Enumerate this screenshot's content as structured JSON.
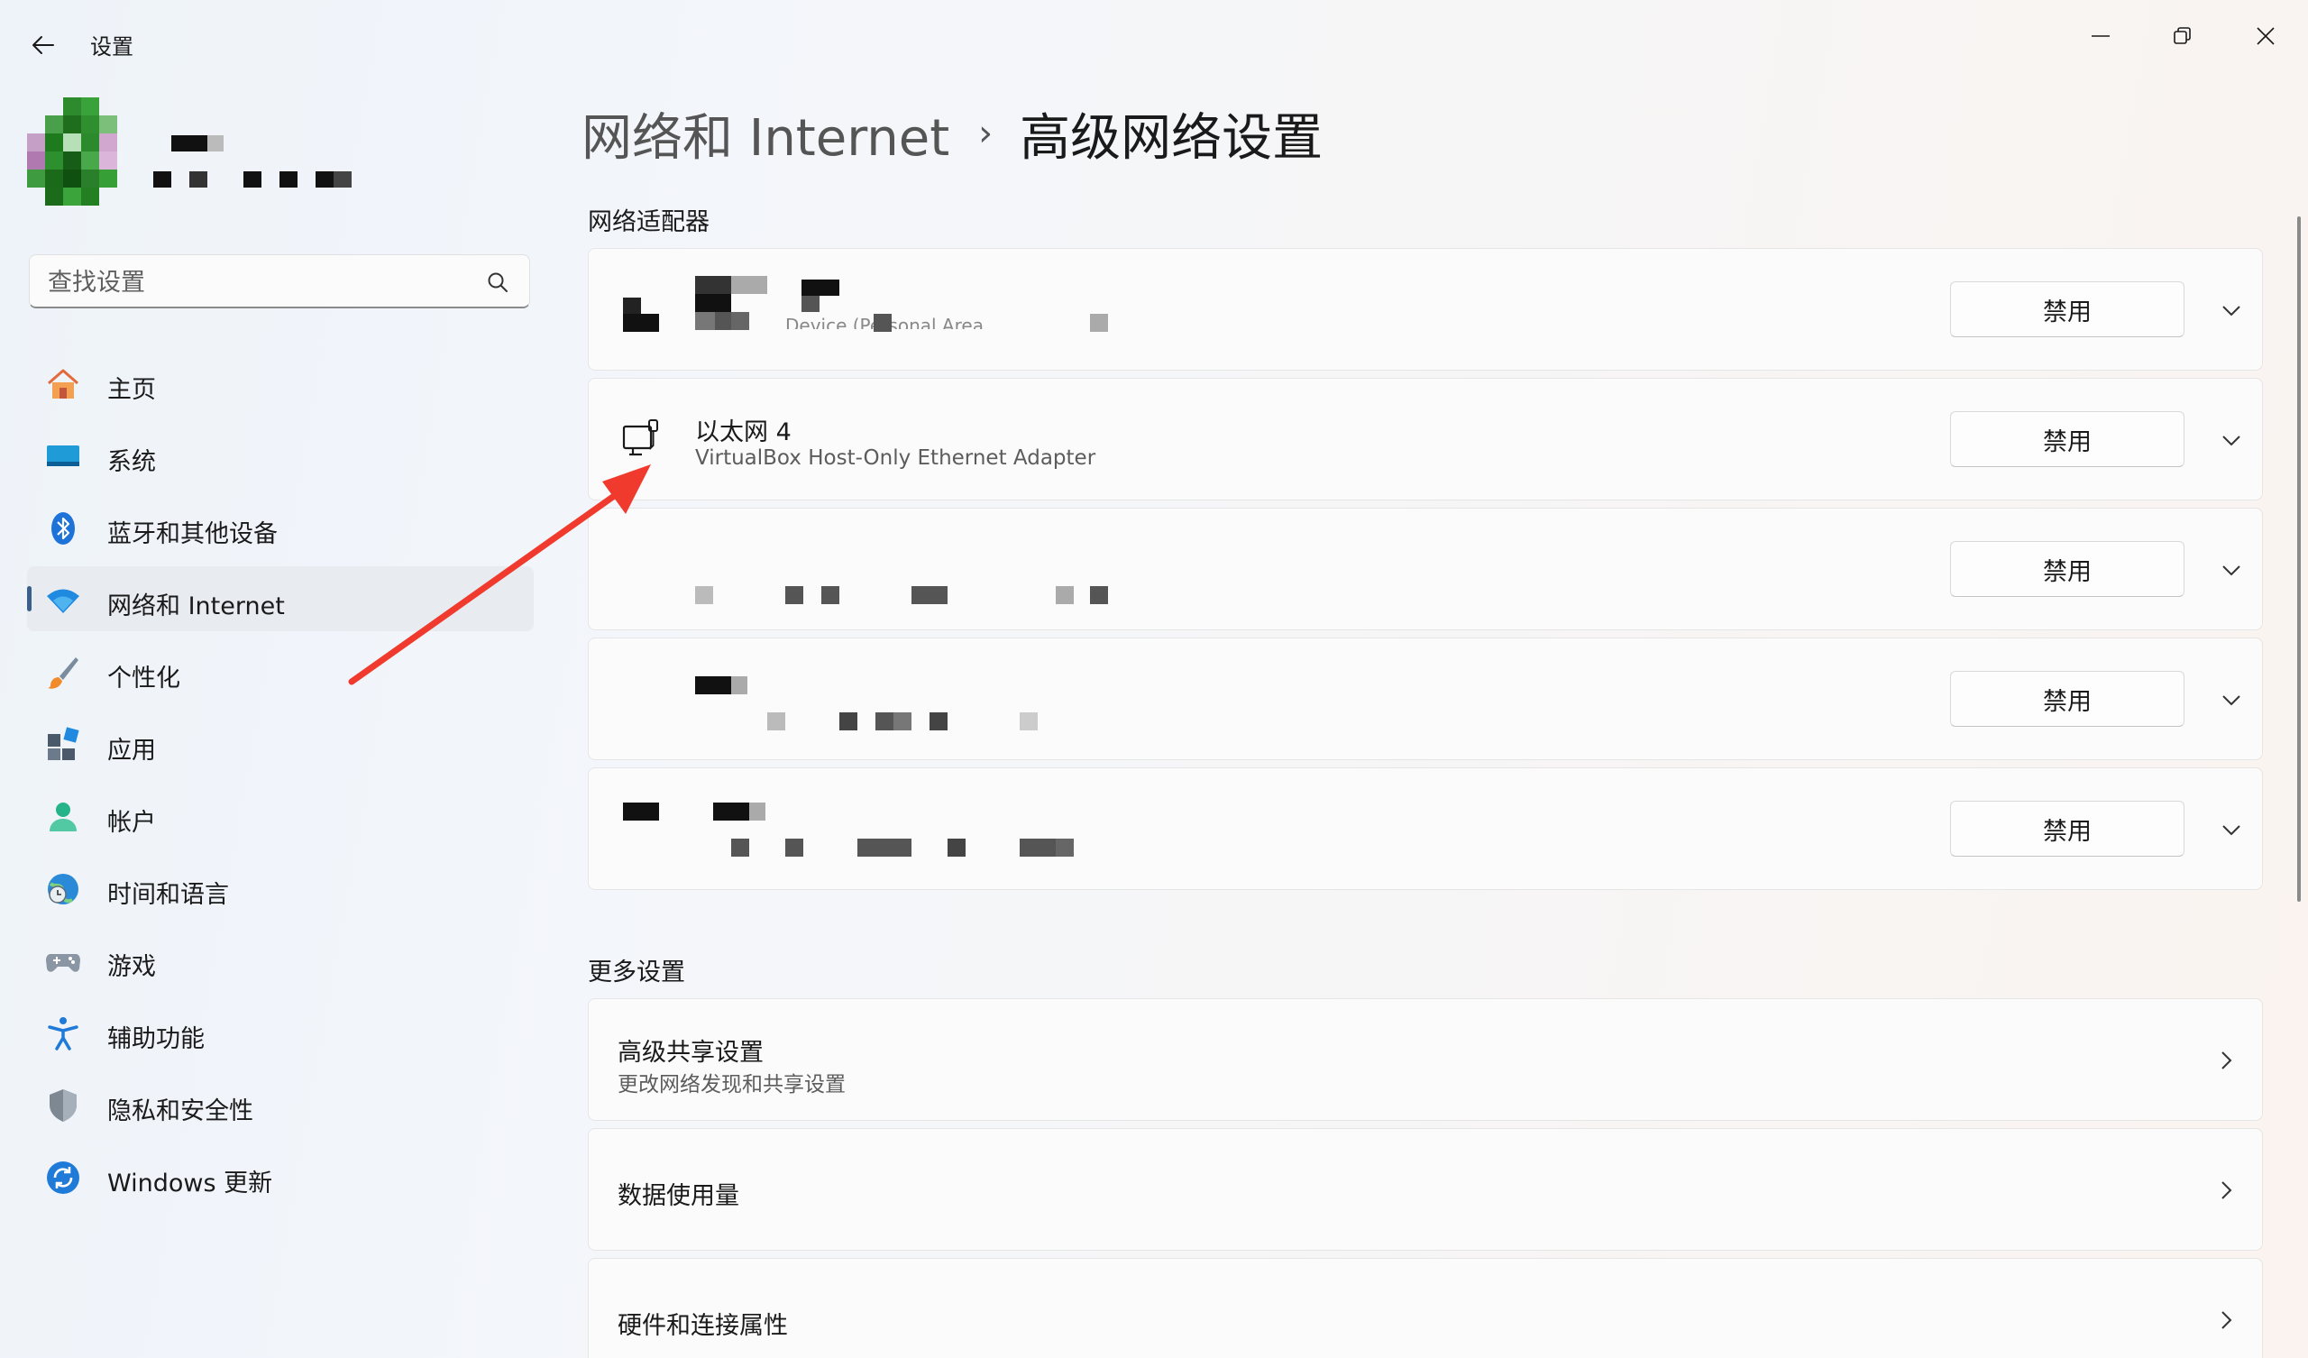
{
  "window": {
    "title": "设置"
  },
  "search": {
    "placeholder": "查找设置"
  },
  "sidebar": {
    "items": [
      {
        "label": "主页",
        "icon": "home-icon"
      },
      {
        "label": "系统",
        "icon": "system-icon"
      },
      {
        "label": "蓝牙和其他设备",
        "icon": "bluetooth-icon"
      },
      {
        "label": "网络和 Internet",
        "icon": "wifi-icon",
        "active": true
      },
      {
        "label": "个性化",
        "icon": "brush-icon"
      },
      {
        "label": "应用",
        "icon": "apps-icon"
      },
      {
        "label": "帐户",
        "icon": "account-icon"
      },
      {
        "label": "时间和语言",
        "icon": "globe-clock-icon"
      },
      {
        "label": "游戏",
        "icon": "gamepad-icon"
      },
      {
        "label": "辅助功能",
        "icon": "accessibility-icon"
      },
      {
        "label": "隐私和安全性",
        "icon": "shield-icon"
      },
      {
        "label": "Windows 更新",
        "icon": "update-icon"
      }
    ]
  },
  "breadcrumb": {
    "parent": "网络和 Internet",
    "separator": "›",
    "current": "高级网络设置"
  },
  "adapters": {
    "section_title": "网络适配器",
    "disable_label": "禁用",
    "items": [
      {
        "name": "",
        "description": "Device (Personal Area",
        "redacted": true
      },
      {
        "name": "以太网 4",
        "description": "VirtualBox Host-Only Ethernet Adapter",
        "redacted": false
      },
      {
        "name": "",
        "description": "",
        "redacted": true
      },
      {
        "name": "",
        "description": "",
        "redacted": true
      },
      {
        "name": "",
        "description": "",
        "redacted": true
      }
    ]
  },
  "more_settings": {
    "section_title": "更多设置",
    "items": [
      {
        "title": "高级共享设置",
        "subtitle": "更改网络发现和共享设置"
      },
      {
        "title": "数据使用量",
        "subtitle": ""
      },
      {
        "title": "硬件和连接属性",
        "subtitle": ""
      }
    ]
  },
  "colors": {
    "accent": "#3a5f8a",
    "annotation_arrow": "#f03a2e"
  }
}
